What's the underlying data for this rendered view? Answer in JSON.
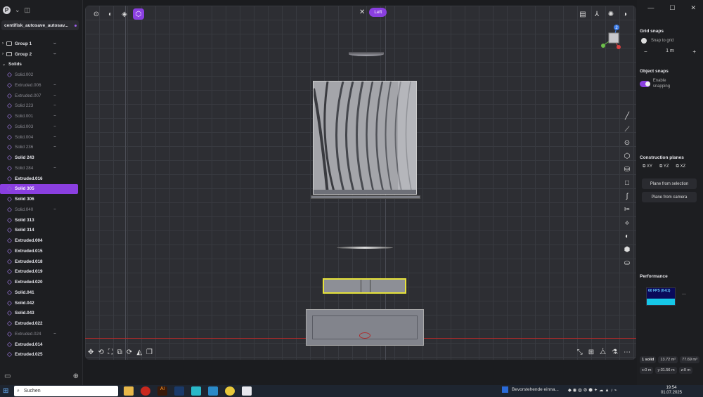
{
  "app": {
    "logo_letter": "P",
    "project_tab": "centifisk_autosave_autosav..."
  },
  "sidebar": {
    "groups": [
      {
        "label": "Group 1"
      },
      {
        "label": "Group 2"
      }
    ],
    "solids_header": "Solids",
    "items": [
      {
        "label": "Solid.002",
        "state": "dim",
        "hidden": false
      },
      {
        "label": "Extruded.006",
        "state": "dim",
        "hidden": true
      },
      {
        "label": "Extruded.007",
        "state": "dim",
        "hidden": true
      },
      {
        "label": "Solid 223",
        "state": "dim",
        "hidden": true
      },
      {
        "label": "Solid.001",
        "state": "dim",
        "hidden": true
      },
      {
        "label": "Solid.003",
        "state": "dim",
        "hidden": true
      },
      {
        "label": "Solid.004",
        "state": "dim",
        "hidden": true
      },
      {
        "label": "Solid 236",
        "state": "dim",
        "hidden": true
      },
      {
        "label": "Solid 243",
        "state": "bright",
        "hidden": false
      },
      {
        "label": "Solid 284",
        "state": "dim",
        "hidden": true
      },
      {
        "label": "Extruded.016",
        "state": "bright",
        "hidden": false
      },
      {
        "label": "Solid 305",
        "state": "selected",
        "hidden": false
      },
      {
        "label": "Solid 306",
        "state": "bright",
        "hidden": false
      },
      {
        "label": "Solid.040",
        "state": "dim",
        "hidden": true
      },
      {
        "label": "Solid 313",
        "state": "bright",
        "hidden": false
      },
      {
        "label": "Solid 314",
        "state": "bright",
        "hidden": false
      },
      {
        "label": "Extruded.004",
        "state": "bright",
        "hidden": false
      },
      {
        "label": "Extruded.015",
        "state": "bright",
        "hidden": false
      },
      {
        "label": "Extruded.018",
        "state": "bright",
        "hidden": false
      },
      {
        "label": "Extruded.019",
        "state": "bright",
        "hidden": false
      },
      {
        "label": "Extruded.020",
        "state": "bright",
        "hidden": false
      },
      {
        "label": "Solid.041",
        "state": "bright",
        "hidden": false
      },
      {
        "label": "Solid.042",
        "state": "bright",
        "hidden": false
      },
      {
        "label": "Solid.043",
        "state": "bright",
        "hidden": false
      },
      {
        "label": "Extruded.022",
        "state": "bright",
        "hidden": false
      },
      {
        "label": "Extruded.024",
        "state": "dim",
        "hidden": true
      },
      {
        "label": "Extruded.014",
        "state": "bright",
        "hidden": false
      },
      {
        "label": "Extruded.025",
        "state": "bright",
        "hidden": false
      }
    ]
  },
  "viewport": {
    "view_label": "Left",
    "gizmo_badge": "2"
  },
  "right_panel": {
    "grid_snaps": {
      "title": "Grid snaps",
      "snap_label": "Snap to grid",
      "grid_value": "1 m",
      "minus": "−",
      "plus": "+"
    },
    "object_snaps": {
      "title": "Object snaps",
      "enable_label": "Enable snapping"
    },
    "construction": {
      "title": "Construction planes",
      "planes": [
        "XY",
        "YZ",
        "XZ"
      ],
      "btn_selection": "Plane from selection",
      "btn_camera": "Plane from camera"
    },
    "performance": {
      "title": "Performance",
      "fps": "60 FPS (0-61)",
      "more": "..."
    },
    "status": {
      "solids": "1 solid",
      "area": "13.72 m²",
      "volume": "77.69 m³",
      "x": "x:0 m",
      "y": "y:31.56 m",
      "z": "z:0 m"
    }
  },
  "taskbar": {
    "search_placeholder": "Suchen",
    "notification": "Bevorstehende einna...",
    "time": "19:54",
    "date": "01.07.2025"
  },
  "colors": {
    "accent": "#8a3fe0",
    "selection_outline": "#e6e23a",
    "axis_red": "#b02a2a"
  }
}
